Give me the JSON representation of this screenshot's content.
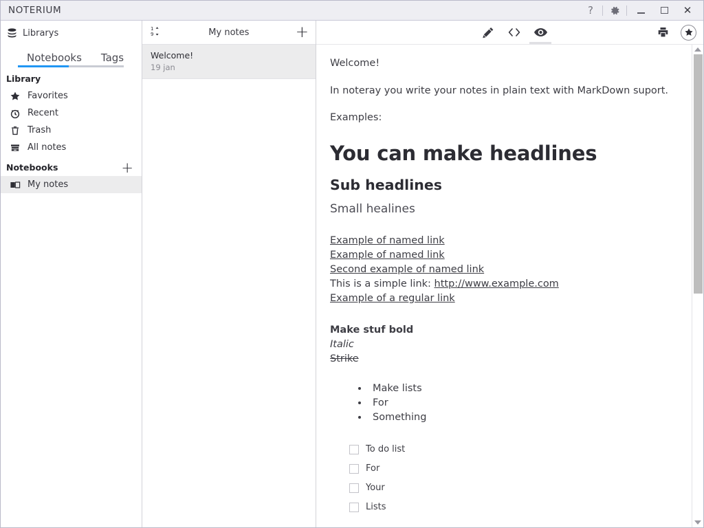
{
  "window": {
    "title": "NOTERIUM",
    "controls": {
      "help": "?",
      "settings": "gear-icon",
      "minimize": "minimize",
      "maximize": "maximize",
      "close": "close"
    }
  },
  "sidebar": {
    "library_header": "Librarys",
    "tabs": [
      {
        "label": "Notebooks",
        "active": true
      },
      {
        "label": "Tags",
        "active": false
      }
    ],
    "active_tab_color": "#2196f3",
    "library_section": {
      "title": "Library",
      "items": [
        {
          "label": "Favorites",
          "icon": "star-icon"
        },
        {
          "label": "Recent",
          "icon": "clock-icon"
        },
        {
          "label": "Trash",
          "icon": "trash-icon"
        },
        {
          "label": "All notes",
          "icon": "archive-icon"
        }
      ]
    },
    "notebooks_section": {
      "title": "Notebooks",
      "add_label": "+",
      "items": [
        {
          "label": "My notes",
          "icon": "book-icon",
          "selected": true
        }
      ]
    }
  },
  "notelist": {
    "sort_icon": "sort-numeric-icon",
    "title": "My notes",
    "add_label": "+",
    "notes": [
      {
        "title": "Welcome!",
        "date": "19 jan",
        "selected": true
      }
    ]
  },
  "editor": {
    "toolbar": {
      "edit": "pencil-icon",
      "source": "code-icon",
      "preview": "eye-icon",
      "print": "printer-icon",
      "favorite": "star-circle-icon",
      "active_mode": "preview"
    },
    "content": {
      "greeting": "Welcome!",
      "intro": "In noteray you write your notes in plain text with MarkDown suport.",
      "examples_label": "Examples:",
      "h1": "You can make headlines",
      "h2": "Sub headlines",
      "h3": "Small healines",
      "links": [
        {
          "text": "Example of named link",
          "type": "link"
        },
        {
          "text": "Example of named link",
          "type": "link"
        },
        {
          "text": "Second example of named link",
          "type": "link"
        },
        {
          "prefix": "This is a simple link: ",
          "text": "http://www.example.com",
          "type": "mixed"
        },
        {
          "text": "Example of a regular link",
          "type": "link"
        }
      ],
      "styles": [
        {
          "text": "Make stuf bold",
          "style": "bold"
        },
        {
          "text": "Italic",
          "style": "italic"
        },
        {
          "text": "Strike",
          "style": "strike"
        }
      ],
      "bullets": [
        "Make lists",
        "For",
        "Something"
      ],
      "todos": [
        {
          "label": "To do list",
          "checked": false
        },
        {
          "label": "For",
          "checked": false
        },
        {
          "label": "Your",
          "checked": false
        },
        {
          "label": "Lists",
          "checked": false
        }
      ]
    },
    "scrollbar": {
      "up_arrow": "scroll-up-arrow",
      "down_arrow": "scroll-down-arrow"
    }
  }
}
